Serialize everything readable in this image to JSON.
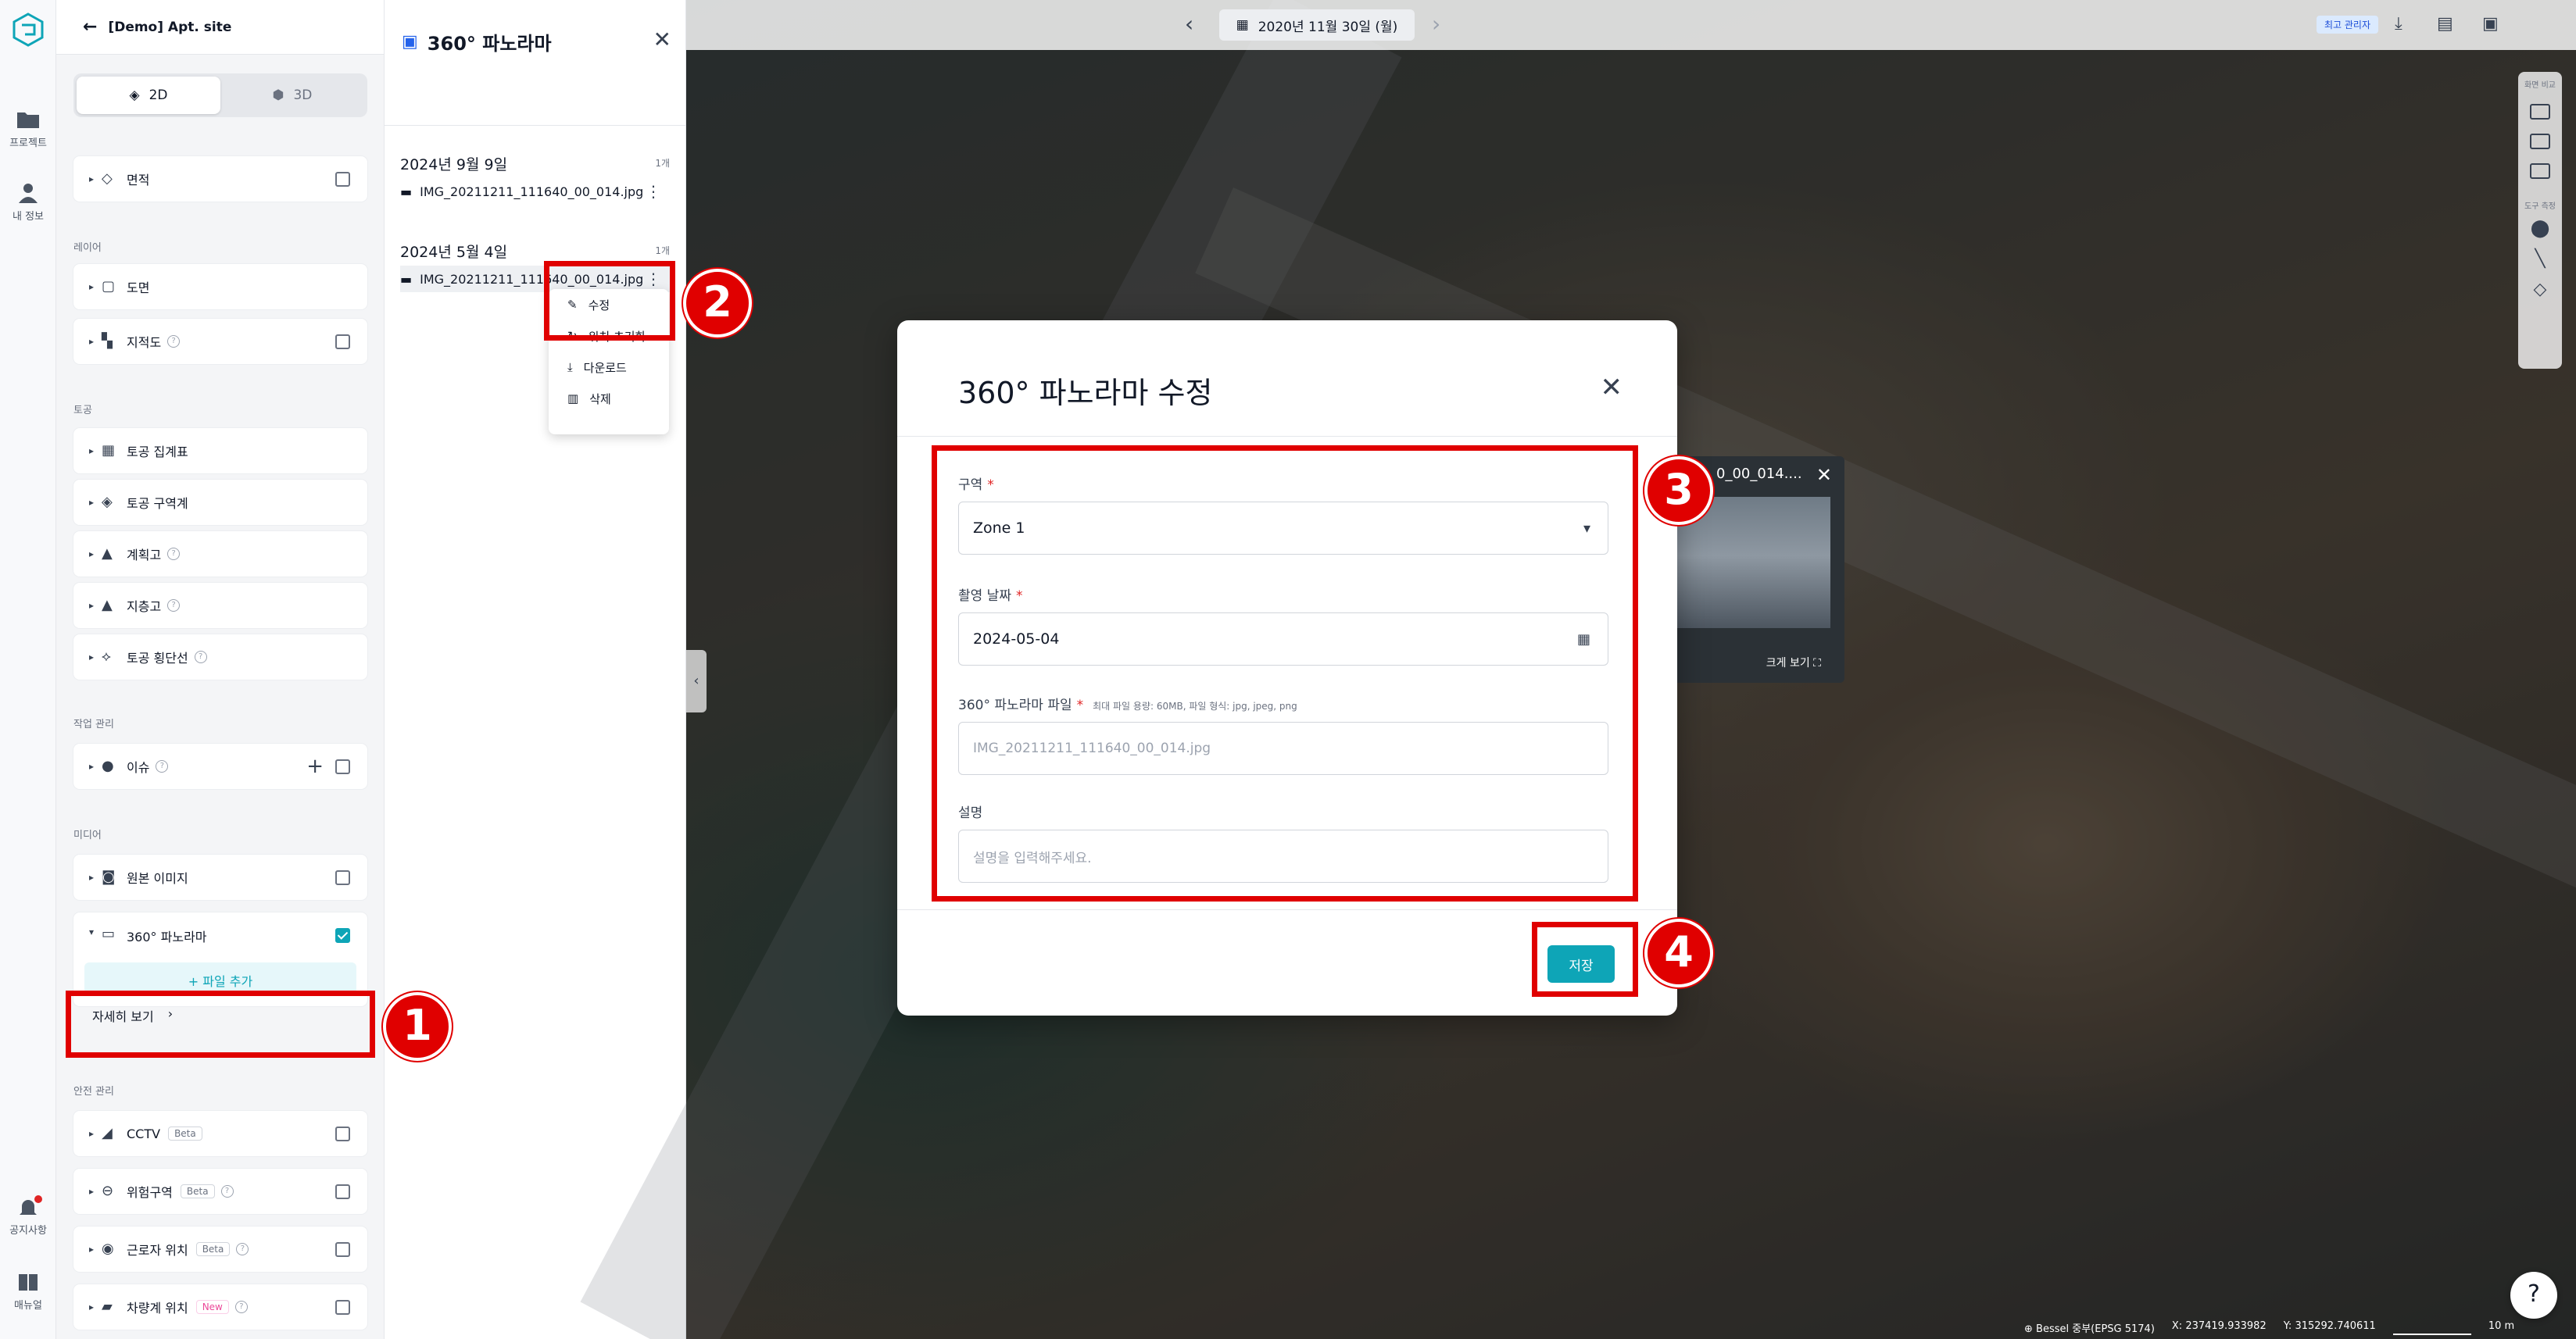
{
  "rail": {
    "items": [
      {
        "label": "프로젝트",
        "icon": "folder-icon"
      },
      {
        "label": "내 정보",
        "icon": "user-icon"
      },
      {
        "label": "공지사항",
        "icon": "bell-icon"
      },
      {
        "label": "매뉴얼",
        "icon": "book-icon"
      }
    ]
  },
  "sidebar": {
    "site_title": "[Demo] Apt. site",
    "view_2d": "2D",
    "view_3d": "3D",
    "top_layer": "면적",
    "sections": {
      "layers": "레이어",
      "earthwork": "토공",
      "work": "작업 관리",
      "media": "미디어",
      "safety": "안전 관리"
    },
    "layers": [
      "도면",
      "지적도"
    ],
    "earthwork": [
      "토공 집계표",
      "토공 구역계",
      "계획고",
      "지층고",
      "토공 횡단선"
    ],
    "work": [
      "이슈"
    ],
    "media": [
      "원본 이미지",
      "360° 파노라마"
    ],
    "add_file": "+ 파일 추가",
    "detail_link": "자세히 보기",
    "safety": [
      {
        "label": "CCTV",
        "badge": "Beta"
      },
      {
        "label": "위험구역",
        "badge": "Beta"
      },
      {
        "label": "근로자 위치",
        "badge": "Beta"
      },
      {
        "label": "차량계 위치",
        "badge": "New"
      }
    ]
  },
  "pano_panel": {
    "title": "360° 파노라마",
    "groups": [
      {
        "date": "2024년 9월 9일",
        "count": "1개",
        "file": "IMG_20211211_111640_00_014.jpg"
      },
      {
        "date": "2024년 5월 4일",
        "count": "1개",
        "file": "IMG_20211211_111640_00_014.jpg"
      }
    ],
    "menu": [
      "수정",
      "위치 초기화",
      "다운로드",
      "삭제"
    ]
  },
  "map": {
    "date": "2020년 11월 30일 (월)",
    "admin_badge": "최고 관리자",
    "tools_label_1": "화면 비교",
    "tools_label_2": "도구 측정",
    "status": {
      "crs": "Bessel 중부(EPSG 5174)",
      "x": "X: 237419.933982",
      "y": "Y: 315292.740611",
      "scale": "10 m"
    },
    "preview_title": "0_00_014....",
    "preview_more": "크게 보기",
    "help": "?"
  },
  "modal": {
    "title": "360° 파노라마 수정",
    "zone_label": "구역",
    "zone_value": "Zone 1",
    "date_label": "촬영 날짜",
    "date_value": "2024-05-04",
    "file_label": "360° 파노라마 파일",
    "file_hint": "최대 파일 용량: 60MB, 파일 형식: jpg, jpeg, png",
    "file_placeholder": "IMG_20211211_111640_00_014.jpg",
    "desc_label": "설명",
    "desc_placeholder": "설명을 입력해주세요.",
    "save": "저장"
  },
  "annotations": [
    "1",
    "2",
    "3",
    "4"
  ],
  "colors": {
    "accent": "#0ea5b7",
    "annotation": "#e00000"
  }
}
